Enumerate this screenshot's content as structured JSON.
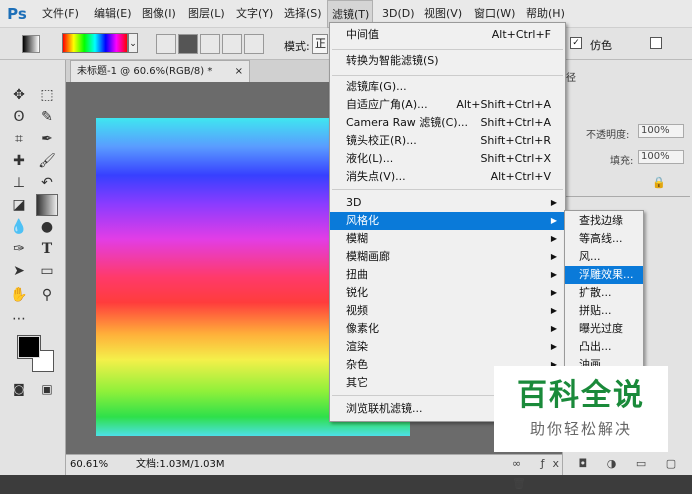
{
  "app": {
    "logo": "Ps"
  },
  "menubar": {
    "items": [
      "文件(F)",
      "编辑(E)",
      "图像(I)",
      "图层(L)",
      "文字(Y)",
      "选择(S)",
      "滤镜(T)",
      "3D(D)",
      "视图(V)",
      "窗口(W)",
      "帮助(H)"
    ],
    "active": "滤镜(T)"
  },
  "options": {
    "mode_label": "模式:",
    "mode_value": "正",
    "fake_label": "仿色",
    "gradient_dropdown": "⌄"
  },
  "document": {
    "tab_title": "未标题-1 @ 60.6%(RGB/8) *",
    "close": "×"
  },
  "status": {
    "zoom": "60.61%",
    "doc_info": "文档:1.03M/1.03M"
  },
  "filter_menu": {
    "items": [
      {
        "label": "中间值",
        "shortcut": "Alt+Ctrl+F"
      },
      {
        "label": "转换为智能滤镜(S)",
        "shortcut": ""
      },
      {
        "label": "滤镜库(G)...",
        "shortcut": ""
      },
      {
        "label": "自适应广角(A)...",
        "shortcut": "Alt+Shift+Ctrl+A"
      },
      {
        "label": "Camera Raw 滤镜(C)...",
        "shortcut": "Shift+Ctrl+A"
      },
      {
        "label": "镜头校正(R)...",
        "shortcut": "Shift+Ctrl+R"
      },
      {
        "label": "液化(L)...",
        "shortcut": "Shift+Ctrl+X"
      },
      {
        "label": "消失点(V)...",
        "shortcut": "Alt+Ctrl+V"
      },
      {
        "label": "3D",
        "shortcut": ""
      },
      {
        "label": "风格化",
        "shortcut": ""
      },
      {
        "label": "模糊",
        "shortcut": ""
      },
      {
        "label": "模糊画廊",
        "shortcut": ""
      },
      {
        "label": "扭曲",
        "shortcut": ""
      },
      {
        "label": "锐化",
        "shortcut": ""
      },
      {
        "label": "视频",
        "shortcut": ""
      },
      {
        "label": "像素化",
        "shortcut": ""
      },
      {
        "label": "渲染",
        "shortcut": ""
      },
      {
        "label": "杂色",
        "shortcut": ""
      },
      {
        "label": "其它",
        "shortcut": ""
      },
      {
        "label": "浏览联机滤镜...",
        "shortcut": ""
      }
    ],
    "highlighted": "风格化"
  },
  "stylize_submenu": {
    "items": [
      "查找边缘",
      "等高线...",
      "风...",
      "浮雕效果...",
      "扩散...",
      "拼贴...",
      "曝光过度",
      "凸出...",
      "油画..."
    ],
    "highlighted": "浮雕效果..."
  },
  "layers_panel": {
    "tab_fragment": "径",
    "opacity_label": "不透明度:",
    "opacity_value": "100%",
    "fill_label": "填充:",
    "fill_value": "100%"
  },
  "watermark": {
    "title": "百科全说",
    "subtitle": "助你轻松解决"
  },
  "colors": {
    "menu_highlight": "#0a7ad9",
    "watermark_green": "#1a8a3a"
  }
}
